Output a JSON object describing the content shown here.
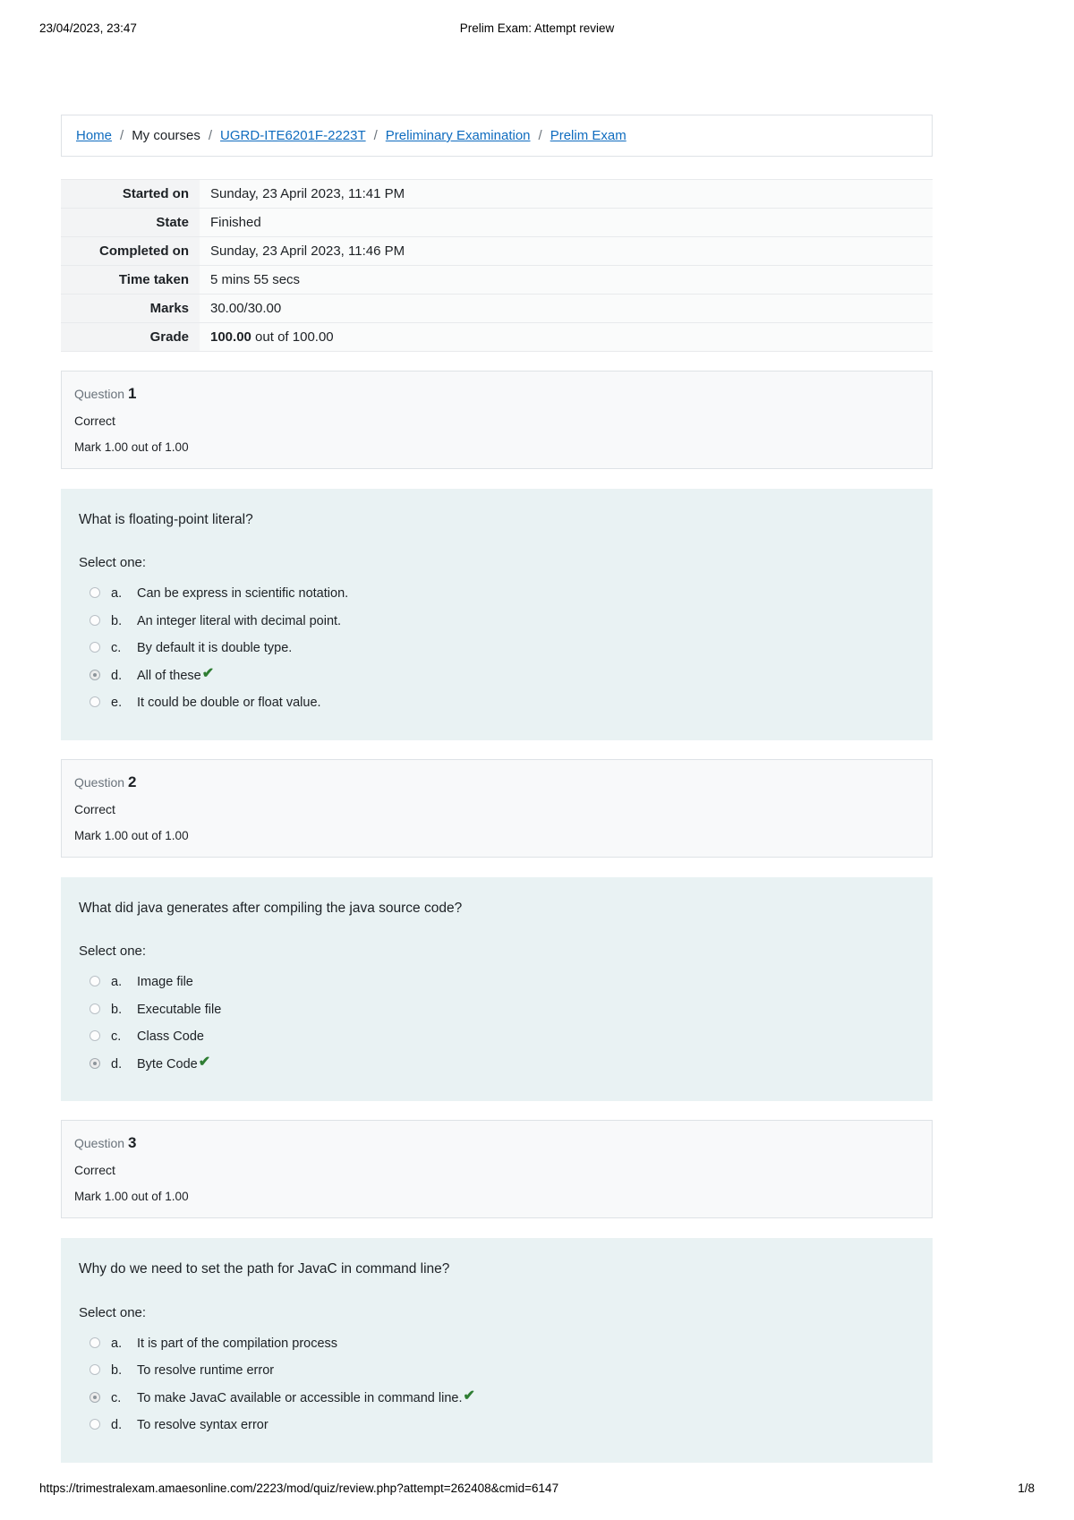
{
  "print_header": {
    "date": "23/04/2023, 23:47",
    "title": "Prelim Exam: Attempt review"
  },
  "print_footer": {
    "url": "https://trimestralexam.amaesonline.com/2223/mod/quiz/review.php?attempt=262408&cmid=6147",
    "page": "1/8"
  },
  "breadcrumb": {
    "items": [
      {
        "label": "Home",
        "link": true
      },
      {
        "label": "My courses",
        "link": false
      },
      {
        "label": "UGRD-ITE6201F-2223T",
        "link": true
      },
      {
        "label": "Preliminary Examination",
        "link": true
      },
      {
        "label": "Prelim Exam",
        "link": true
      }
    ],
    "separator": "/"
  },
  "summary": {
    "rows": [
      {
        "label": "Started on",
        "value": "Sunday, 23 April 2023, 11:41 PM"
      },
      {
        "label": "State",
        "value": "Finished"
      },
      {
        "label": "Completed on",
        "value": "Sunday, 23 April 2023, 11:46 PM"
      },
      {
        "label": "Time taken",
        "value": "5 mins 55 secs"
      },
      {
        "label": "Marks",
        "value": "30.00/30.00"
      }
    ],
    "grade_label": "Grade",
    "grade_value_strong": "100.00",
    "grade_value_rest": " out of 100.00"
  },
  "questions": [
    {
      "number_label": "Question",
      "number": "1",
      "state": "Correct",
      "mark": "Mark 1.00 out of 1.00",
      "text": "What is floating-point literal?",
      "prompt": "Select one:",
      "answers": [
        {
          "letter": "a.",
          "text": "Can be express in scientific notation.",
          "selected": false,
          "correct_mark": false
        },
        {
          "letter": "b.",
          "text": "An integer literal with decimal point.",
          "selected": false,
          "correct_mark": false
        },
        {
          "letter": "c.",
          "text": "By default it is double type.",
          "selected": false,
          "correct_mark": false
        },
        {
          "letter": "d.",
          "text": "All of these",
          "selected": true,
          "correct_mark": true
        },
        {
          "letter": "e.",
          "text": "It could be double or float value.",
          "selected": false,
          "correct_mark": false
        }
      ]
    },
    {
      "number_label": "Question",
      "number": "2",
      "state": "Correct",
      "mark": "Mark 1.00 out of 1.00",
      "text": "What did java generates after compiling the java source code?",
      "prompt": "Select one:",
      "answers": [
        {
          "letter": "a.",
          "text": "Image file",
          "selected": false,
          "correct_mark": false
        },
        {
          "letter": "b.",
          "text": "Executable file",
          "selected": false,
          "correct_mark": false
        },
        {
          "letter": "c.",
          "text": "Class Code",
          "selected": false,
          "correct_mark": false
        },
        {
          "letter": "d.",
          "text": "Byte Code",
          "selected": true,
          "correct_mark": true
        }
      ]
    },
    {
      "number_label": "Question",
      "number": "3",
      "state": "Correct",
      "mark": "Mark 1.00 out of 1.00",
      "text": "Why do we need to set the path for JavaC in command line?",
      "prompt": "Select one:",
      "answers": [
        {
          "letter": "a.",
          "text": "It is part of the compilation process",
          "selected": false,
          "correct_mark": false
        },
        {
          "letter": "b.",
          "text": "To resolve runtime error",
          "selected": false,
          "correct_mark": false
        },
        {
          "letter": "c.",
          "text": "To make JavaC available or accessible in command line.",
          "selected": true,
          "correct_mark": true
        },
        {
          "letter": "d.",
          "text": "To resolve syntax error",
          "selected": false,
          "correct_mark": false
        }
      ]
    }
  ],
  "icons": {
    "correct_tick": "✔"
  },
  "colors": {
    "link": "#0f6cbf",
    "question_bg": "#e9f2f3",
    "info_bg": "#f8f9fa",
    "tick_green": "#2e7d32"
  }
}
